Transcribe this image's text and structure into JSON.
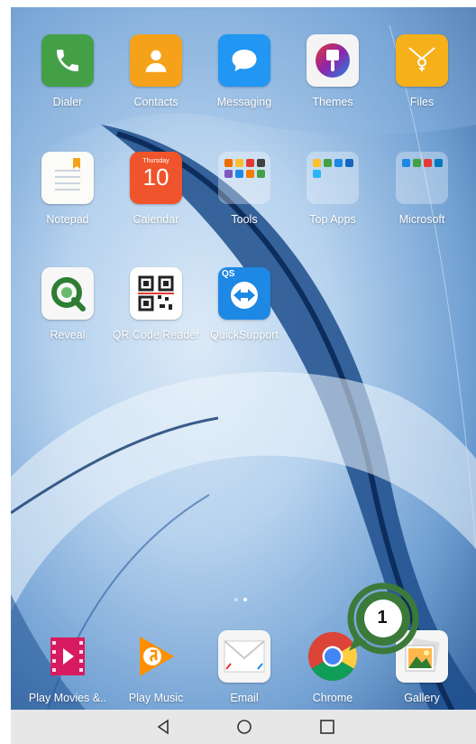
{
  "home": {
    "row1": [
      {
        "label": "Dialer",
        "icon": "phone-icon"
      },
      {
        "label": "Contacts",
        "icon": "contacts-icon"
      },
      {
        "label": "Messaging",
        "icon": "chat-bubble-icon"
      },
      {
        "label": "Themes",
        "icon": "paintbrush-icon"
      },
      {
        "label": "Files",
        "icon": "folder-envelope-icon"
      }
    ],
    "row2": [
      {
        "label": "Notepad",
        "icon": "notepad-icon"
      },
      {
        "label": "Calendar",
        "icon": "calendar-icon",
        "day": "Thursday",
        "date": "10"
      },
      {
        "label": "Tools",
        "icon": "folder-icon"
      },
      {
        "label": "Top Apps",
        "icon": "folder-icon"
      },
      {
        "label": "Microsoft",
        "icon": "folder-icon"
      }
    ],
    "row3": [
      {
        "label": "Reveal",
        "icon": "reveal-icon"
      },
      {
        "label": "QR Code Reader",
        "icon": "qr-code-icon"
      },
      {
        "label": "QuickSupport",
        "icon": "quicksupport-icon",
        "badge": "QS"
      }
    ]
  },
  "dock": [
    {
      "label": "Play Movies &..",
      "icon": "play-movies-icon"
    },
    {
      "label": "Play Music",
      "icon": "play-music-icon"
    },
    {
      "label": "Email",
      "icon": "email-icon"
    },
    {
      "label": "Chrome",
      "icon": "chrome-icon"
    },
    {
      "label": "Gallery",
      "icon": "gallery-icon"
    }
  ],
  "callout": {
    "number": "1",
    "ring_color": "#3c7a3a"
  },
  "navbar": {
    "back": "back-icon",
    "home": "home-icon",
    "recents": "recents-icon"
  },
  "colors": {
    "dialer": "#43a047",
    "contacts": "#f5a21a",
    "messaging": "#2196f3",
    "files": "#f5b01a",
    "calendar": "#f0542c",
    "quicksupport": "#1e88e5"
  }
}
